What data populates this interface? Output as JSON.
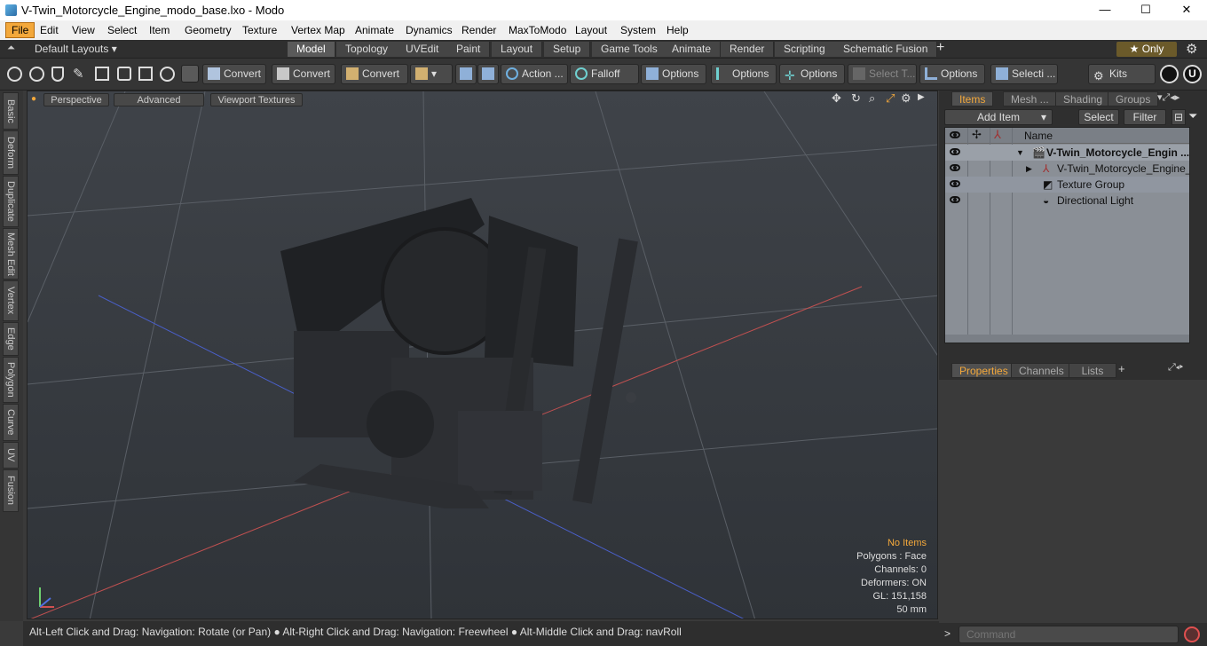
{
  "window": {
    "title": "V-Twin_Motorcycle_Engine_modo_base.lxo - Modo",
    "minimize": "—",
    "maximize": "☐",
    "close": "✕"
  },
  "menu": [
    "File",
    "Edit",
    "View",
    "Select",
    "Item",
    "Geometry",
    "Texture",
    "Vertex Map",
    "Animate",
    "Dynamics",
    "Render",
    "MaxToModo",
    "Layout",
    "System",
    "Help"
  ],
  "layouts": {
    "dropdown": "Default Layouts ▾",
    "tabs": [
      "Model",
      "Topology",
      "UVEdit",
      "Paint",
      "Layout",
      "Setup",
      "Game Tools",
      "Animate",
      "Render",
      "Scripting",
      "Schematic Fusion"
    ],
    "selected": "Model",
    "add": "+",
    "only": "★  Only",
    "gear": "⚙"
  },
  "toolbar": {
    "convert1": "Convert",
    "convert2": "Convert",
    "convert3": "Convert",
    "action": "Action ...",
    "falloff": "Falloff",
    "options1": "Options",
    "options2": "Options",
    "options3": "Options",
    "select_t": "Select T...",
    "options4": "Options",
    "selecti": "Selecti ...",
    "kits": "Kits"
  },
  "left_tabs": [
    "Basic",
    "Deform",
    "Duplicate",
    "Mesh Edit",
    "Vertex",
    "Edge",
    "Polygon",
    "Curve",
    "UV",
    "Fusion"
  ],
  "viewport": {
    "view": "Perspective",
    "shading": "Advanced",
    "textures": "Viewport Textures",
    "stats": {
      "selection": "No Items",
      "polygons": "Polygons : Face",
      "channels": "Channels: 0",
      "deformers": "Deformers: ON",
      "gl": "GL: 151,158",
      "scale": "50 mm"
    },
    "accent": "#f3a83b"
  },
  "status": "Alt-Left Click and Drag: Navigation: Rotate (or Pan) ● Alt-Right Click and Drag: Navigation: Freewheel ● Alt-Middle Click and Drag: navRoll",
  "items_panel": {
    "tabs": [
      "Items",
      "Mesh ...",
      "Shading",
      "Groups"
    ],
    "add_item": "Add Item",
    "select": "Select",
    "filter": "Filter",
    "column_name": "Name",
    "rows": [
      {
        "label": "V-Twin_Motorcycle_Engin ..."
      },
      {
        "label": "V-Twin_Motorcycle_Engine_ ..."
      },
      {
        "label": "Texture Group"
      },
      {
        "label": "Directional Light"
      }
    ]
  },
  "properties_panel": {
    "tabs": [
      "Properties",
      "Channels",
      "Lists"
    ],
    "add": "+"
  },
  "command": {
    "placeholder": "Command",
    "prompt": ">"
  }
}
